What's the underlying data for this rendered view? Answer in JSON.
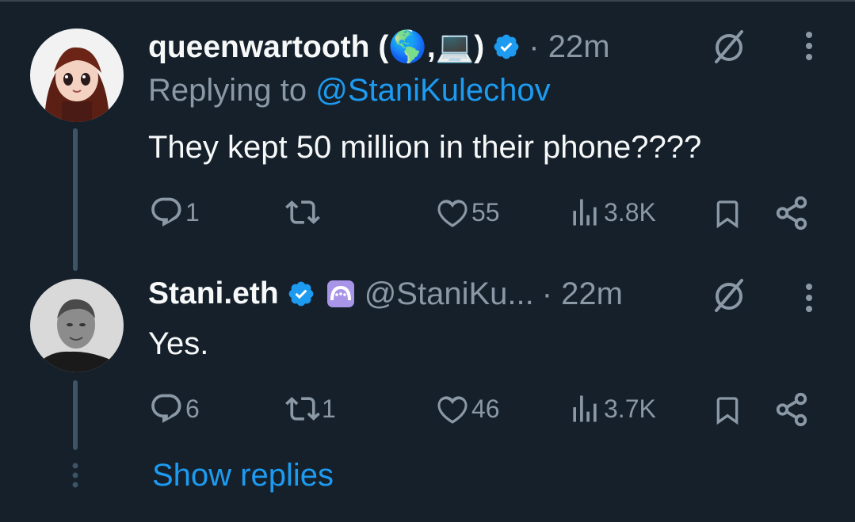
{
  "tweets": [
    {
      "display_name": "queenwartooth (🌎,💻)",
      "time": "· 22m",
      "replying_prefix": "Replying to ",
      "replying_mention": "@StaniKulechov",
      "text": "They kept 50 million in their phone????",
      "replies": "1",
      "retweets": "",
      "likes": "55",
      "views": "3.8K"
    },
    {
      "display_name": "Stani.eth",
      "handle": "@StaniKu...",
      "time": "· 22m",
      "text": "Yes.",
      "replies": "6",
      "retweets": "1",
      "likes": "46",
      "views": "3.7K"
    }
  ],
  "show_replies": "Show replies",
  "colors": {
    "background": "#15202b",
    "accent": "#1d9bf0",
    "muted": "#8b98a5",
    "text": "#f7f9f9"
  }
}
